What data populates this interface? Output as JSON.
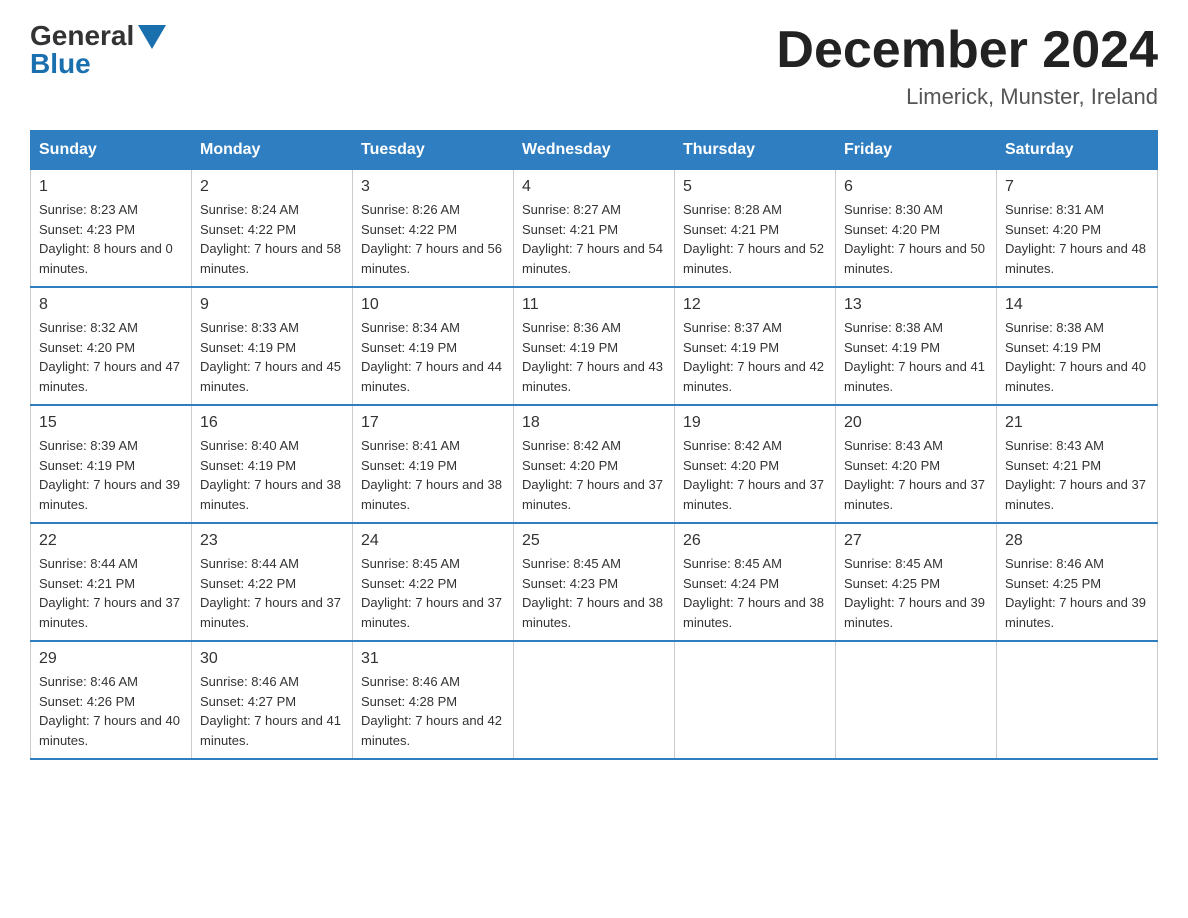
{
  "logo": {
    "general": "General",
    "blue": "Blue",
    "triangle_color": "#1a6faf"
  },
  "header": {
    "month_year": "December 2024",
    "location": "Limerick, Munster, Ireland"
  },
  "days_of_week": [
    "Sunday",
    "Monday",
    "Tuesday",
    "Wednesday",
    "Thursday",
    "Friday",
    "Saturday"
  ],
  "weeks": [
    [
      {
        "day": "1",
        "sunrise": "8:23 AM",
        "sunset": "4:23 PM",
        "daylight": "8 hours and 0 minutes."
      },
      {
        "day": "2",
        "sunrise": "8:24 AM",
        "sunset": "4:22 PM",
        "daylight": "7 hours and 58 minutes."
      },
      {
        "day": "3",
        "sunrise": "8:26 AM",
        "sunset": "4:22 PM",
        "daylight": "7 hours and 56 minutes."
      },
      {
        "day": "4",
        "sunrise": "8:27 AM",
        "sunset": "4:21 PM",
        "daylight": "7 hours and 54 minutes."
      },
      {
        "day": "5",
        "sunrise": "8:28 AM",
        "sunset": "4:21 PM",
        "daylight": "7 hours and 52 minutes."
      },
      {
        "day": "6",
        "sunrise": "8:30 AM",
        "sunset": "4:20 PM",
        "daylight": "7 hours and 50 minutes."
      },
      {
        "day": "7",
        "sunrise": "8:31 AM",
        "sunset": "4:20 PM",
        "daylight": "7 hours and 48 minutes."
      }
    ],
    [
      {
        "day": "8",
        "sunrise": "8:32 AM",
        "sunset": "4:20 PM",
        "daylight": "7 hours and 47 minutes."
      },
      {
        "day": "9",
        "sunrise": "8:33 AM",
        "sunset": "4:19 PM",
        "daylight": "7 hours and 45 minutes."
      },
      {
        "day": "10",
        "sunrise": "8:34 AM",
        "sunset": "4:19 PM",
        "daylight": "7 hours and 44 minutes."
      },
      {
        "day": "11",
        "sunrise": "8:36 AM",
        "sunset": "4:19 PM",
        "daylight": "7 hours and 43 minutes."
      },
      {
        "day": "12",
        "sunrise": "8:37 AM",
        "sunset": "4:19 PM",
        "daylight": "7 hours and 42 minutes."
      },
      {
        "day": "13",
        "sunrise": "8:38 AM",
        "sunset": "4:19 PM",
        "daylight": "7 hours and 41 minutes."
      },
      {
        "day": "14",
        "sunrise": "8:38 AM",
        "sunset": "4:19 PM",
        "daylight": "7 hours and 40 minutes."
      }
    ],
    [
      {
        "day": "15",
        "sunrise": "8:39 AM",
        "sunset": "4:19 PM",
        "daylight": "7 hours and 39 minutes."
      },
      {
        "day": "16",
        "sunrise": "8:40 AM",
        "sunset": "4:19 PM",
        "daylight": "7 hours and 38 minutes."
      },
      {
        "day": "17",
        "sunrise": "8:41 AM",
        "sunset": "4:19 PM",
        "daylight": "7 hours and 38 minutes."
      },
      {
        "day": "18",
        "sunrise": "8:42 AM",
        "sunset": "4:20 PM",
        "daylight": "7 hours and 37 minutes."
      },
      {
        "day": "19",
        "sunrise": "8:42 AM",
        "sunset": "4:20 PM",
        "daylight": "7 hours and 37 minutes."
      },
      {
        "day": "20",
        "sunrise": "8:43 AM",
        "sunset": "4:20 PM",
        "daylight": "7 hours and 37 minutes."
      },
      {
        "day": "21",
        "sunrise": "8:43 AM",
        "sunset": "4:21 PM",
        "daylight": "7 hours and 37 minutes."
      }
    ],
    [
      {
        "day": "22",
        "sunrise": "8:44 AM",
        "sunset": "4:21 PM",
        "daylight": "7 hours and 37 minutes."
      },
      {
        "day": "23",
        "sunrise": "8:44 AM",
        "sunset": "4:22 PM",
        "daylight": "7 hours and 37 minutes."
      },
      {
        "day": "24",
        "sunrise": "8:45 AM",
        "sunset": "4:22 PM",
        "daylight": "7 hours and 37 minutes."
      },
      {
        "day": "25",
        "sunrise": "8:45 AM",
        "sunset": "4:23 PM",
        "daylight": "7 hours and 38 minutes."
      },
      {
        "day": "26",
        "sunrise": "8:45 AM",
        "sunset": "4:24 PM",
        "daylight": "7 hours and 38 minutes."
      },
      {
        "day": "27",
        "sunrise": "8:45 AM",
        "sunset": "4:25 PM",
        "daylight": "7 hours and 39 minutes."
      },
      {
        "day": "28",
        "sunrise": "8:46 AM",
        "sunset": "4:25 PM",
        "daylight": "7 hours and 39 minutes."
      }
    ],
    [
      {
        "day": "29",
        "sunrise": "8:46 AM",
        "sunset": "4:26 PM",
        "daylight": "7 hours and 40 minutes."
      },
      {
        "day": "30",
        "sunrise": "8:46 AM",
        "sunset": "4:27 PM",
        "daylight": "7 hours and 41 minutes."
      },
      {
        "day": "31",
        "sunrise": "8:46 AM",
        "sunset": "4:28 PM",
        "daylight": "7 hours and 42 minutes."
      },
      {
        "day": "",
        "sunrise": "",
        "sunset": "",
        "daylight": ""
      },
      {
        "day": "",
        "sunrise": "",
        "sunset": "",
        "daylight": ""
      },
      {
        "day": "",
        "sunrise": "",
        "sunset": "",
        "daylight": ""
      },
      {
        "day": "",
        "sunrise": "",
        "sunset": "",
        "daylight": ""
      }
    ]
  ]
}
